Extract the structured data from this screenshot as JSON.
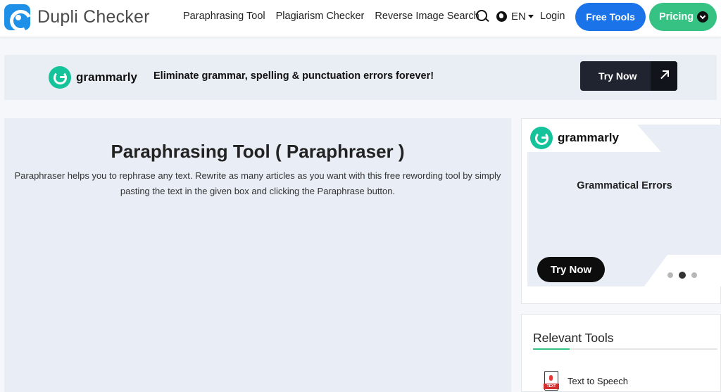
{
  "header": {
    "brand": "Dupli Checker",
    "nav": [
      "Paraphrasing Tool",
      "Plagiarism Checker",
      "Reverse Image Search"
    ],
    "language": "EN",
    "login": "Login",
    "free_tools": "Free Tools",
    "pricing": "Pricing"
  },
  "banner": {
    "brand": "grammarly",
    "text": "Eliminate grammar, spelling & punctuation errors forever!",
    "cta": "Try Now"
  },
  "main": {
    "title": "Paraphrasing Tool ( Paraphraser )",
    "description": "Paraphraser helps you to rephrase any text. Rewrite as many articles as you want with this free rewording tool by simply pasting the text in the given box and clicking the Paraphrase button."
  },
  "side_ad": {
    "brand": "grammarly",
    "title": "Grammatical Errors",
    "cta": "Try Now",
    "carousel": {
      "count": 3,
      "active_index": 1
    }
  },
  "relevant_tools": {
    "heading": "Relevant Tools",
    "items": [
      {
        "label": "Text to Speech",
        "icon": "text-file-icon",
        "icon_badge": "TEXT"
      }
    ]
  },
  "colors": {
    "accent_blue": "#1a73e8",
    "accent_green": "#35c283",
    "grammarly_green": "#15c39a",
    "panel_bg": "#e9eef6"
  }
}
